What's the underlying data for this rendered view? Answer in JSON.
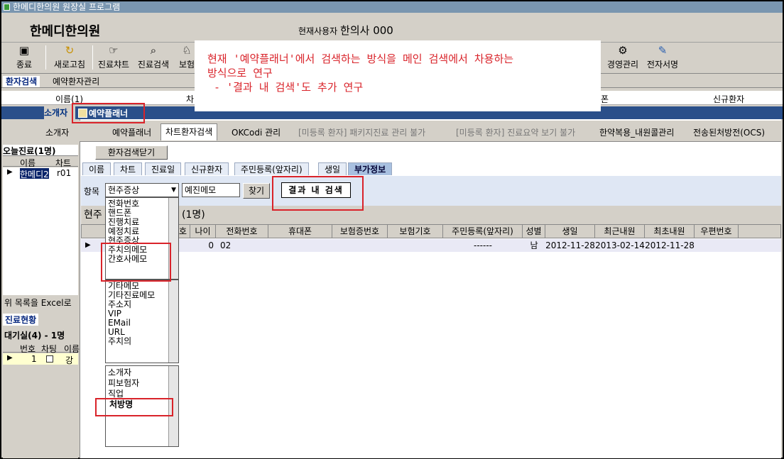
{
  "window": {
    "title": "한메디한의원 원장실 프로그램"
  },
  "header": {
    "clinic_name": "한메디한의원",
    "current_user_label": "현재사용자",
    "current_user": "한의사 000"
  },
  "toolbar": {
    "items": [
      "종료",
      "새로고침",
      "진료챠트",
      "진료검색",
      "보험",
      "경영관리",
      "전자서명"
    ]
  },
  "top_tabs": [
    "환자검색",
    "예약환자관리"
  ],
  "col_headers": {
    "name": "이름(1)",
    "chart": "차",
    "phone_suffix": "폰",
    "new_patient": "신규환자"
  },
  "nav": {
    "referrer": "소개자",
    "planner_title": "예약플래너"
  },
  "left": {
    "referrer": "소개자",
    "today_title": "오늘진료(1명)",
    "col_name": "이름",
    "col_chart": "차트",
    "row_name": "한메디2",
    "row_chart": "r01",
    "excel": "위 목록을 Excel로",
    "status_tab": "진료현황",
    "waiting": "대기실(4) - 1명",
    "w_col_no": "번호",
    "w_col_chart": "차팅",
    "w_col_name": "이름",
    "w_row_no": "1",
    "w_row_name": "강"
  },
  "main_tabs": [
    "예약플래너",
    "차트환자검색",
    "OKCodi 관리",
    "[미등록 환자] 패키지진료 관리 불가",
    "[미등록 환자] 진료요약 보기 불가",
    "한약복용_내원콜관리",
    "전송된처방전(OCS)"
  ],
  "close_button": "환자검색닫기",
  "sub_tabs": [
    "이름",
    "차트",
    "진료일",
    "신규환자",
    "주민등록(앞자리)",
    "생일",
    "부가정보"
  ],
  "search": {
    "item_label": "항목",
    "selected": "현주증상",
    "value": "예진메모",
    "find": "찾기",
    "result_search": "결과 내 검색"
  },
  "result_label": "현주",
  "result_count": "(1명)",
  "grid": {
    "headers": [
      "호",
      "나이",
      "전화번호",
      "휴대폰",
      "보험증번호",
      "보험기호",
      "주민등록(앞자리)",
      "성별",
      "생일",
      "최근내원",
      "최초내원",
      "우편번호"
    ],
    "row": [
      "",
      "0",
      "02",
      "",
      "",
      "",
      "------",
      "남",
      "2012-11-28",
      "2013-02-14",
      "2012-11-28",
      ""
    ]
  },
  "dropdown1": [
    "전화번호",
    "핸드폰",
    "진행치료",
    "예정치료",
    "현주증상",
    "주치의메모",
    "간호사메모"
  ],
  "dropdown2": [
    "기타메모",
    "기타진료메모",
    "주소지",
    "VIP",
    "EMail",
    "URL",
    "주치의"
  ],
  "dropdown3": [
    "소개자",
    "피보험자",
    "직업",
    "처방명"
  ],
  "annotation": {
    "line1": "현재 '예약플래너'에서 검색하는 방식을 메인 검색에서 차용하는",
    "line2": "방식으로 연구",
    "line3": " - '결과 내 검색'도 추가 연구"
  }
}
